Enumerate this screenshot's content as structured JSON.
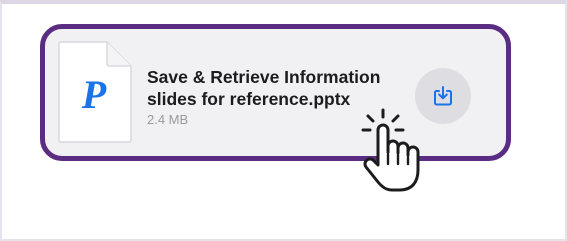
{
  "attachment": {
    "file_name_line1": "Save & Retrieve Information",
    "file_name_line2": "slides for reference.pptx",
    "file_size": "2.4 MB",
    "thumbnail_letter": "P",
    "thumbnail_icon": "pptx-document-icon",
    "download_icon": "download-icon"
  },
  "colors": {
    "card_border": "#5b2d82",
    "card_background": "#f1f1f3",
    "accent_blue": "#1a73e8",
    "download_button_bg": "#dedee2"
  },
  "cursor": {
    "icon": "hand-pointer-click-icon"
  }
}
